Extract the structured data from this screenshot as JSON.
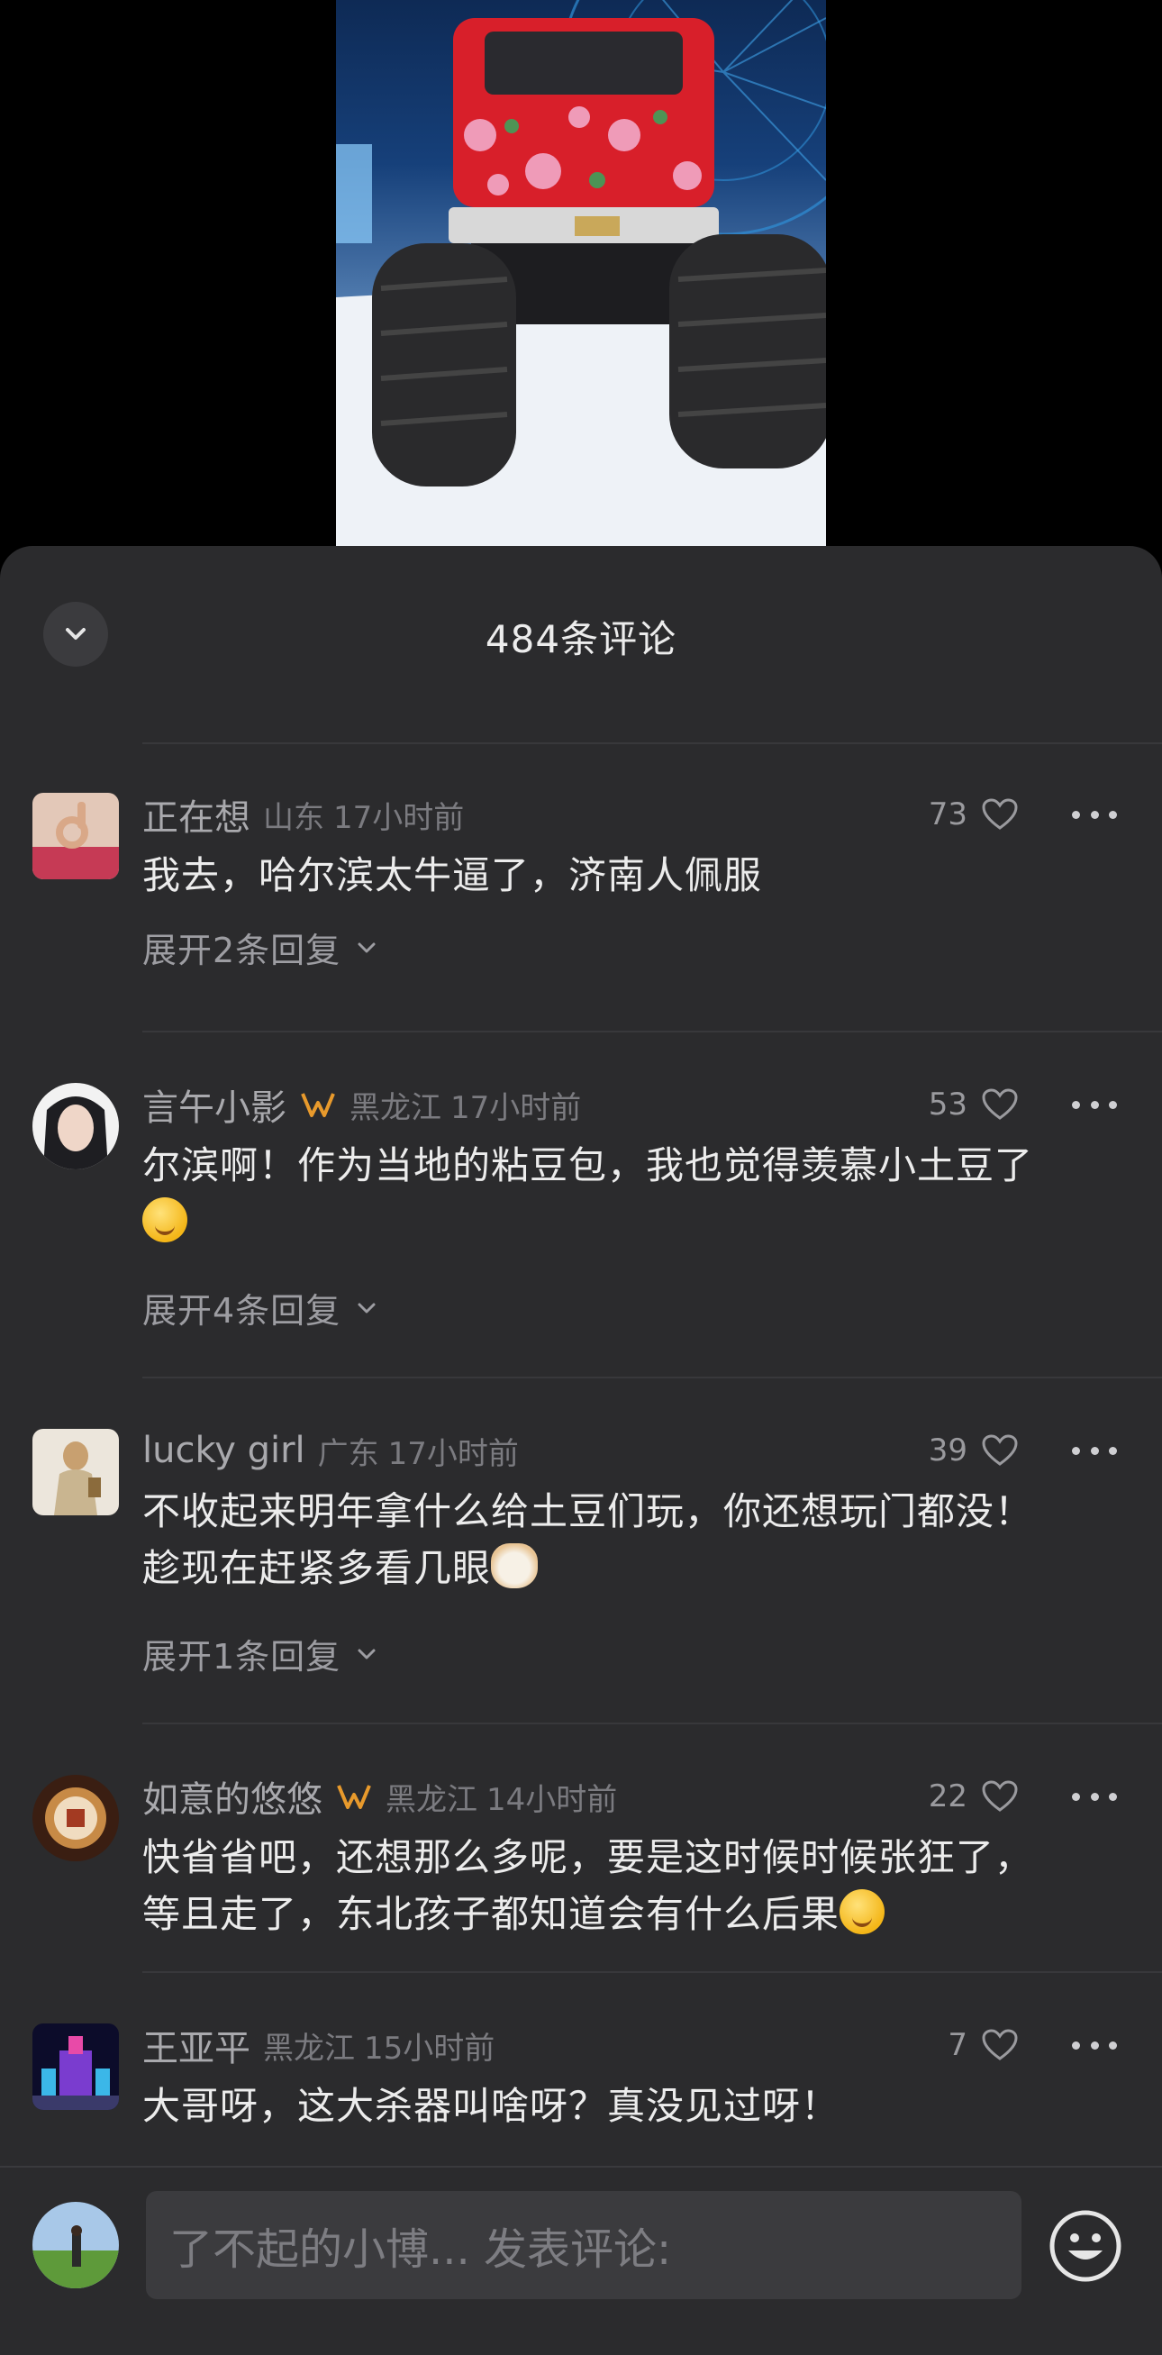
{
  "header": {
    "title": "484条评论"
  },
  "comments": [
    {
      "username": "正在想",
      "region": "山东",
      "time": "17小时前",
      "likes": "73",
      "text": "我去，哈尔滨太牛逼了，济南人佩服",
      "replies": "展开2条回复"
    },
    {
      "username": "言午小影",
      "region": "黑龙江",
      "time": "17小时前",
      "likes": "53",
      "text_line1": "尔滨啊！作为当地的粘豆包，我也觉得羡慕小土豆了",
      "replies": "展开4条回复"
    },
    {
      "username": "lucky girl",
      "region": "广东",
      "time": "17小时前",
      "likes": "39",
      "text_line1": "不收起来明年拿什么给土豆们玩，你还想玩门都没！",
      "text_line2": "趁现在赶紧多看几眼",
      "replies": "展开1条回复"
    },
    {
      "username": "如意的悠悠",
      "region": "黑龙江",
      "time": "14小时前",
      "likes": "22",
      "text_line1": "快省省吧，还想那么多呢，要是这时候时候张狂了，",
      "text_line2": "等且走了，东北孩子都知道会有什么后果"
    },
    {
      "username": "王亚平",
      "region": "黑龙江",
      "time": "15小时前",
      "likes": "7",
      "text": "大哥呀，这大杀器叫啥呀？真没见过呀！"
    }
  ],
  "composer": {
    "placeholder": "了不起的小博... 发表评论:"
  },
  "icons": {
    "collapse": "chevron-down-icon",
    "like": "heart-outline-icon",
    "more": "more-dots-icon",
    "expand": "chevron-down-icon",
    "badge": "fan-badge-icon",
    "emoji": "emoji-smile-icon"
  },
  "colors": {
    "sheet_bg": "#2b2b2d",
    "badge": "#e89a2c"
  }
}
